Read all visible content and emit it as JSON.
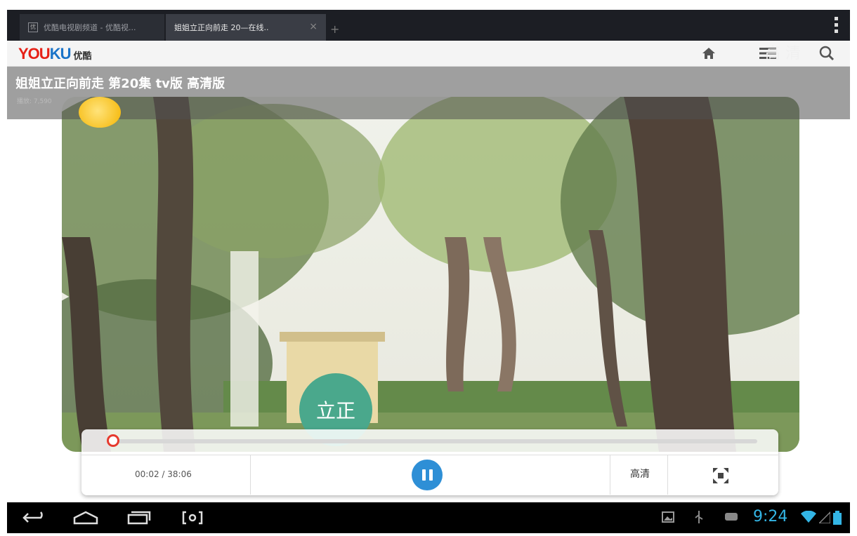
{
  "browser": {
    "tabs": [
      {
        "title": "优酷电视剧频道 - 优酷视...",
        "active": false
      },
      {
        "title": "姐姐立正向前走 20—在线..",
        "active": true
      }
    ],
    "new_tab_symbol": "+",
    "close_symbol": "×"
  },
  "site": {
    "logo_you": "YOU",
    "logo_ku": "KU",
    "logo_cn": "优酷",
    "icons": [
      "home-icon",
      "menu-icon",
      "search-icon"
    ]
  },
  "video": {
    "title": "姐姐立正向前走 第20集 tv版 高清版",
    "subtitle": "播放: 7,590",
    "quality_tag": "高 清",
    "caption_text": "立正"
  },
  "player": {
    "time_display": "00:02 / 38:06",
    "progress_fraction": 0.001,
    "quality_button": "高清",
    "accent_color": "#e63a2e",
    "play_color": "#2e8fd6"
  },
  "system": {
    "clock": "9:24",
    "clock_color": "#33b5e5"
  }
}
